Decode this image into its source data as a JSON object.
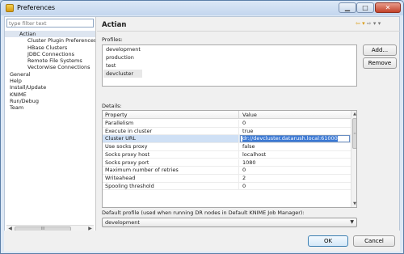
{
  "window": {
    "title": "Preferences",
    "minimize": "▁",
    "maximize": "□",
    "close": "✕"
  },
  "left": {
    "filter_placeholder": "type filter text",
    "tree": [
      {
        "label": "Actian",
        "level": 0,
        "selected": true
      },
      {
        "label": "Cluster Plugin Preferences",
        "level": 1
      },
      {
        "label": "HBase Clusters",
        "level": 1
      },
      {
        "label": "JDBC Connections",
        "level": 1
      },
      {
        "label": "Remote File Systems",
        "level": 1
      },
      {
        "label": "Vectorwise Connections",
        "level": 1
      },
      {
        "label": "General",
        "level": 0
      },
      {
        "label": "Help",
        "level": 0
      },
      {
        "label": "Install/Update",
        "level": 0
      },
      {
        "label": "KNIME",
        "level": 0
      },
      {
        "label": "Run/Debug",
        "level": 0
      },
      {
        "label": "Team",
        "level": 0
      }
    ],
    "scroll_left": "◀",
    "scroll_right": "▶",
    "scroll_thumb": "III"
  },
  "right": {
    "title": "Actian",
    "nav_back": "⇦ ▾",
    "nav_forward": "⇨ ▾",
    "nav_menu": "▾",
    "profiles_label": "Profiles:",
    "profiles": [
      "development",
      "production",
      "test",
      "devcluster"
    ],
    "selected_profile": "devcluster",
    "add_button": "Add...",
    "remove_button": "Remove",
    "details_label": "Details:",
    "columns": [
      "Property",
      "Value"
    ],
    "rows": [
      {
        "property": "Parallelism",
        "value": "0"
      },
      {
        "property": "Execute in cluster",
        "value": "true"
      },
      {
        "property": "Cluster URL",
        "value": "dr://devcluster.datarush.local:61000",
        "editing": true
      },
      {
        "property": "Use socks proxy",
        "value": "false"
      },
      {
        "property": "Socks proxy host",
        "value": "localhost"
      },
      {
        "property": "Socks proxy port",
        "value": "1080"
      },
      {
        "property": "Maximum number of retries",
        "value": "0"
      },
      {
        "property": "Writeahead",
        "value": "2"
      },
      {
        "property": "Spooling threshold",
        "value": "0"
      }
    ],
    "scroll_up": "▲",
    "scroll_down": "▼",
    "scroll_thumb": "≡",
    "default_profile_label": "Default profile (used when running DR nodes in Default KNIME Job Manager):",
    "default_profile_value": "development",
    "dropdown_arrow": "▼"
  },
  "footer": {
    "ok": "OK",
    "cancel": "Cancel"
  }
}
